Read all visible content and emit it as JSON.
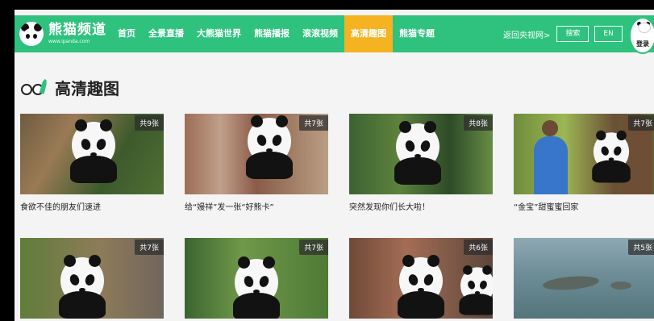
{
  "brand": {
    "title": "熊猫频道",
    "subtitle": "www.ipanda.com"
  },
  "nav": {
    "items": [
      {
        "label": "首页"
      },
      {
        "label": "全景直播"
      },
      {
        "label": "大熊猫世界"
      },
      {
        "label": "熊猫播报"
      },
      {
        "label": "滚滚视频"
      },
      {
        "label": "高清趣图"
      },
      {
        "label": "熊猫专题"
      }
    ],
    "back_link": "返回央视网>",
    "search_label": "搜索",
    "lang_label": "EN",
    "login_label": "登录"
  },
  "section": {
    "title": "高清趣图"
  },
  "cards": [
    {
      "count": "共9张",
      "caption": "食欲不佳的朋友们速进"
    },
    {
      "count": "共7张",
      "caption": "给“嫚祥”发一张“好熊卡”"
    },
    {
      "count": "共8张",
      "caption": "突然发现你们长大啦！"
    },
    {
      "count": "共7张",
      "caption": "“金宝”甜蜜蜜回家"
    },
    {
      "count": "共7张",
      "caption": ""
    },
    {
      "count": "共7张",
      "caption": ""
    },
    {
      "count": "共6张",
      "caption": ""
    },
    {
      "count": "共5张",
      "caption": ""
    }
  ],
  "colors": {
    "primary": "#2ec27e",
    "active": "#f5b321",
    "page_bg": "#f4f4f4"
  }
}
